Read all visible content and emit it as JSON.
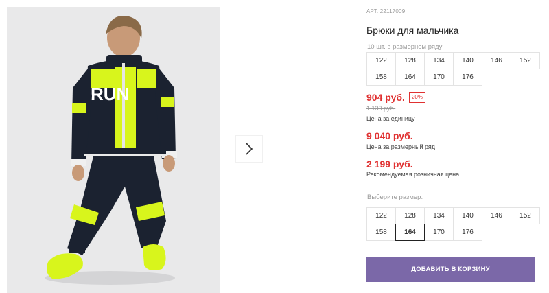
{
  "product": {
    "sku": "АРТ. 22117009",
    "title": "Брюки для мальчика",
    "pack_note": "10 шт. в размерном ряду"
  },
  "pack_sizes": [
    "122",
    "128",
    "134",
    "140",
    "146",
    "152",
    "158",
    "164",
    "170",
    "176"
  ],
  "pricing": {
    "unit_price": "904 руб.",
    "discount": "20%",
    "old_price": "1 130 руб.",
    "unit_caption": "Цена за единицу",
    "series_price": "9 040 руб.",
    "series_caption": "Цена за размерный ряд",
    "retail_price": "2 199 руб.",
    "retail_caption": "Рекомендуемая розничная цена"
  },
  "size_picker": {
    "label": "Выберите размер:",
    "sizes": [
      "122",
      "128",
      "134",
      "140",
      "146",
      "152",
      "158",
      "164",
      "170",
      "176"
    ],
    "selected": "164"
  },
  "actions": {
    "add_to_cart": "ДОБАВИТЬ В КОРЗИНУ"
  },
  "gallery": {
    "next_icon": "chevron-right-icon"
  },
  "colors": {
    "price_red": "#e03131",
    "button_purple": "#7b68a8",
    "neon_yellow": "#d8f51c"
  }
}
